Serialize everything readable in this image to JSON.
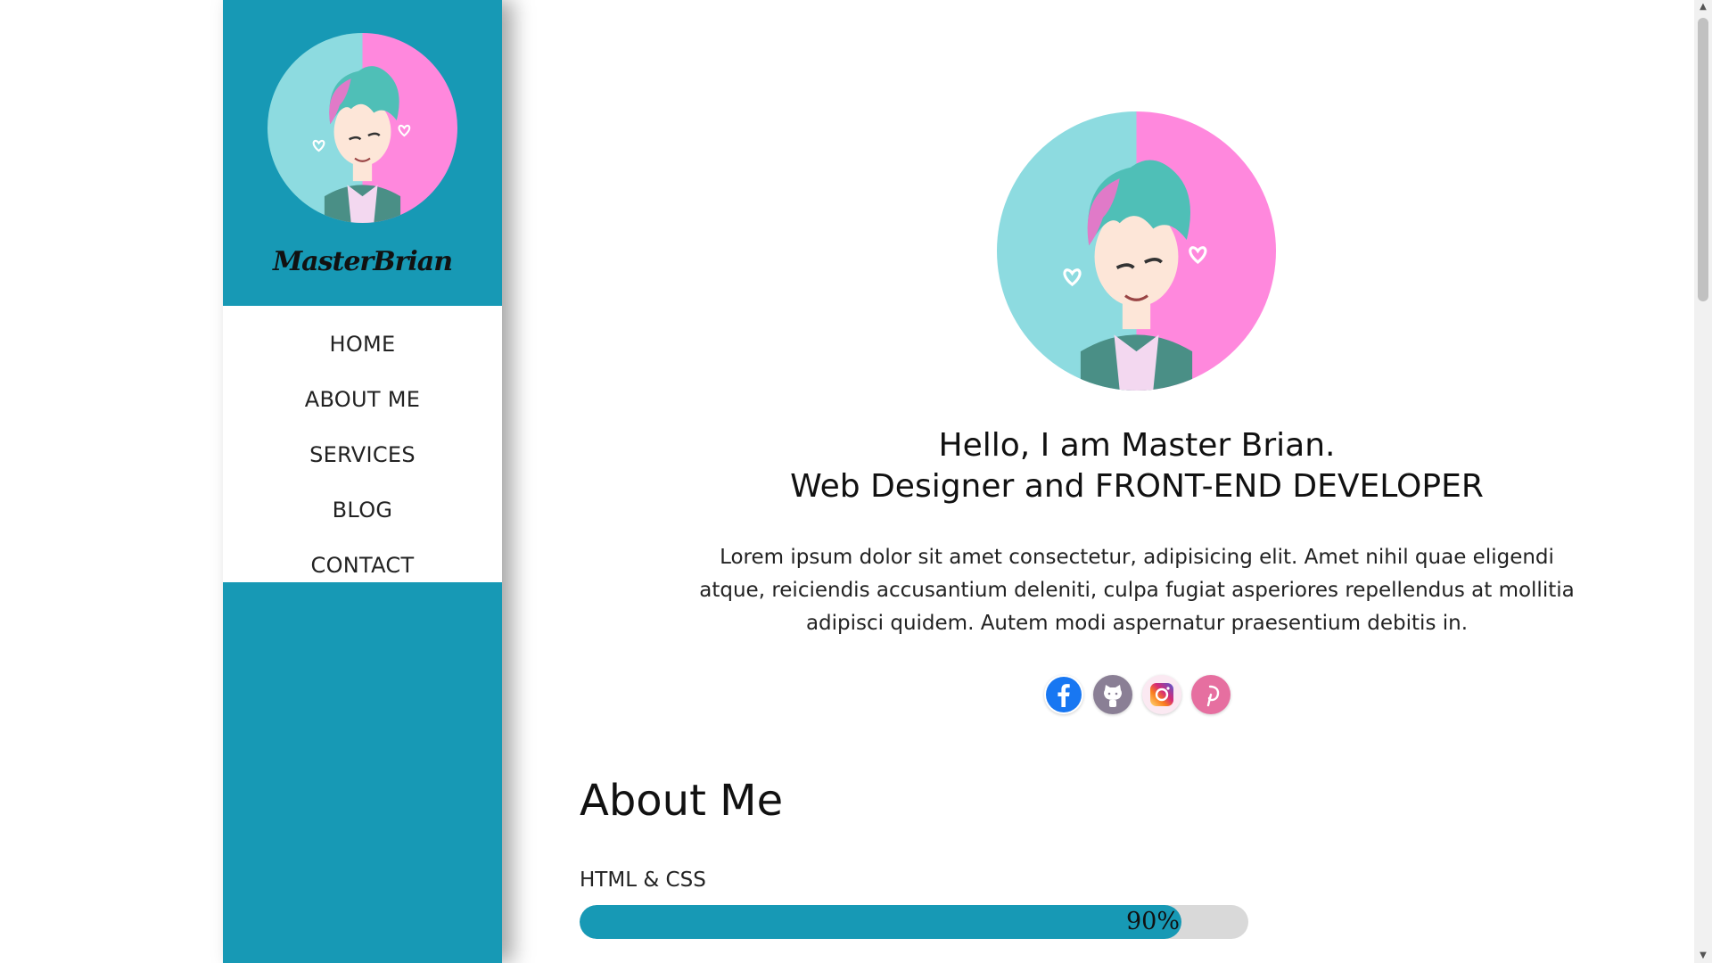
{
  "sidebar": {
    "brand": "MasterBrian",
    "nav": [
      {
        "label": "HOME"
      },
      {
        "label": "ABOUT ME"
      },
      {
        "label": "SERVICES"
      },
      {
        "label": "BLOG"
      },
      {
        "label": "CONTACT"
      }
    ]
  },
  "hero": {
    "title_line1": "Hello, I am Master Brian.",
    "title_line2": "Web Designer and FRONT-END DEVELOPER",
    "description": "Lorem ipsum dolor sit amet consectetur, adipisicing elit. Amet nihil quae eligendi atque, reiciendis accusantium deleniti, culpa fugiat asperiores repellendus at mollitia adipisci quidem. Autem modi aspernatur praesentium debitis in."
  },
  "socials": [
    {
      "icon": "facebook-icon",
      "color": "#1877f2"
    },
    {
      "icon": "github-icon",
      "color": "#8a7f95"
    },
    {
      "icon": "instagram-icon",
      "color": "#e1306c"
    },
    {
      "icon": "pinterest-icon",
      "color": "#e66fa0"
    }
  ],
  "about": {
    "title": "About Me",
    "skills": [
      {
        "name": "HTML & CSS",
        "percent_label": "90%",
        "percent": 90
      }
    ]
  },
  "colors": {
    "accent": "#1799b5",
    "avatar_cyan": "#8ddbe0",
    "avatar_pink": "#ff88dd"
  }
}
